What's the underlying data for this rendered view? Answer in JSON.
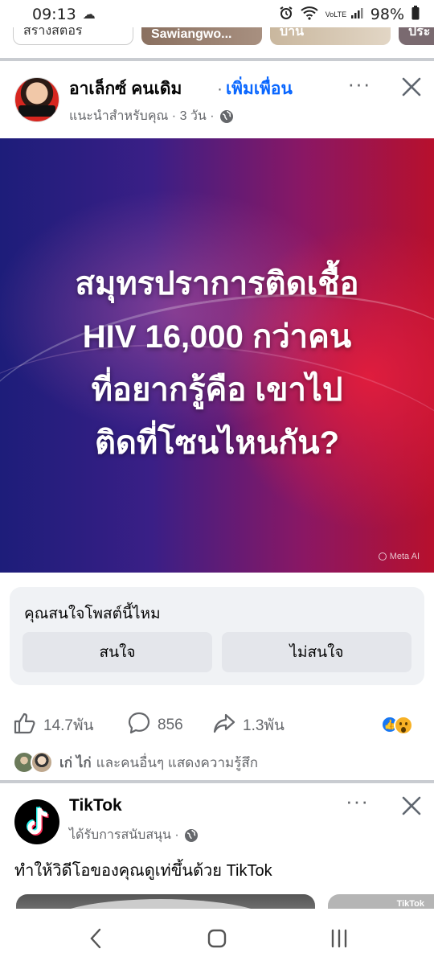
{
  "status_bar": {
    "time": "09:13",
    "battery": "98%",
    "network": "VoLTE"
  },
  "stories": [
    "สร้างสตอรี่",
    "Sawiangwo...",
    "บ้าน",
    "ประ"
  ],
  "post": {
    "author": "อาเล็กซ์ คนเดิม",
    "add_friend": "เพิ่มเพื่อน",
    "separator": "·",
    "meta": "แนะนำสำหรับคุณ · 3 วัน ·",
    "more": "···",
    "headline_lines": [
      "สมุทรปราการติดเชื้อ",
      "HIV 16,000 กว่าคน",
      "ที่อยากรู้คือ เขาไป",
      "ติดที่โซนไหนกัน?"
    ],
    "image_credit": "Meta AI",
    "colors": {
      "image_left": "#1d1d7a",
      "image_right": "#b7102d",
      "link_blue": "#0866ff"
    }
  },
  "interest": {
    "question": "คุณสนใจโพสต์นี้ไหม",
    "yes": "สนใจ",
    "no": "ไม่สนใจ"
  },
  "engagement": {
    "likes": "14.7พัน",
    "comments": "856",
    "shares": "1.3พัน",
    "friends_names": "เก่ ไก่",
    "friends_text": "และคนอื่นๆ แสดงความรู้สึก"
  },
  "sponsored_post": {
    "name": "TikTok",
    "meta": "ได้รับการสนับสนุน ·",
    "more": "···",
    "caption": "ทำให้วิดีโอของคุณดูเท่ขึ้นด้วย TikTok",
    "watermark": "TikTok"
  }
}
